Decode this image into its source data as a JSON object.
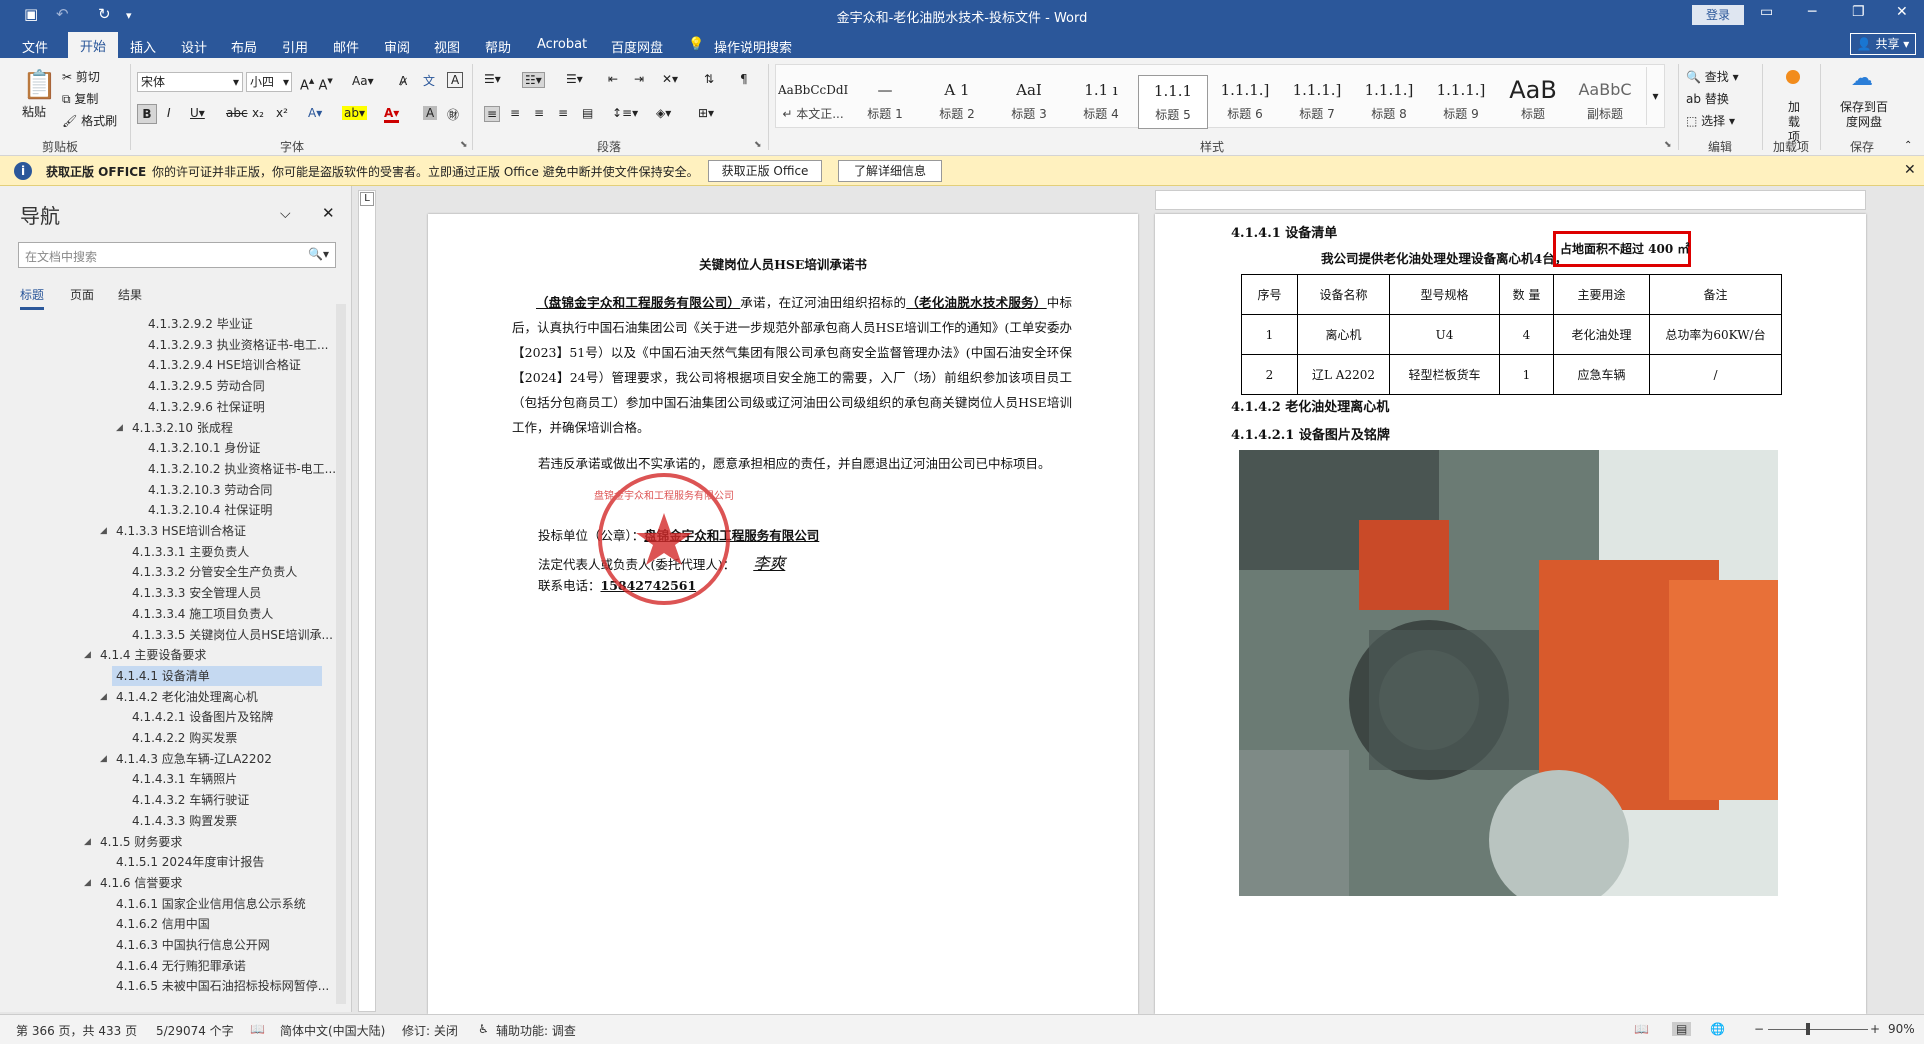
{
  "title_bar": {
    "title": "金宇众和-老化油脱水技术-投标文件 - Word",
    "login": "登录"
  },
  "menu_tabs": [
    "文件",
    "开始",
    "插入",
    "设计",
    "布局",
    "引用",
    "邮件",
    "审阅",
    "视图",
    "帮助",
    "Acrobat",
    "百度网盘"
  ],
  "tell_me": "操作说明搜索",
  "share": "共享",
  "ribbon": {
    "clipboard": {
      "paste": "粘贴",
      "cut": "剪切",
      "copy": "复制",
      "format_painter": "格式刷",
      "label": "剪贴板"
    },
    "font": {
      "name": "宋体",
      "size": "小四",
      "label": "字体"
    },
    "paragraph": {
      "label": "段落"
    },
    "styles": {
      "label": "样式",
      "items": [
        {
          "preview": "AaBbCcDdI",
          "name": "↵ 本文正..."
        },
        {
          "preview": "—",
          "name": "标题 1"
        },
        {
          "preview": "A 1",
          "name": "标题 2"
        },
        {
          "preview": "AaI",
          "name": "标题 3"
        },
        {
          "preview": "1.1 ı",
          "name": "标题 4"
        },
        {
          "preview": "1.1.1",
          "name": "标题 5"
        },
        {
          "preview": "1.1.1.]",
          "name": "标题 6"
        },
        {
          "preview": "1.1.1.]",
          "name": "标题 7"
        },
        {
          "preview": "1.1.1.]",
          "name": "标题 8"
        },
        {
          "preview": "1.1.1.]",
          "name": "标题 9"
        },
        {
          "preview": "AaB",
          "name": "标题"
        },
        {
          "preview": "AaBbC",
          "name": "副标题"
        }
      ]
    },
    "editing": {
      "find": "查找",
      "replace": "替换",
      "select": "选择",
      "label": "编辑"
    },
    "addins": {
      "name": "加载项",
      "label": "加载项"
    },
    "save": {
      "name": "保存到百度网盘",
      "label": "保存"
    }
  },
  "info_bar": {
    "title": "获取正版 OFFICE",
    "message": "你的许可证并非正版，你可能是盗版软件的受害者。立即通过正版 Office 避免中断并使文件保持安全。",
    "btn_get": "获取正版 Office",
    "btn_more": "了解详细信息"
  },
  "nav": {
    "title": "导航",
    "search_placeholder": "在文档中搜索",
    "tabs": [
      "标题",
      "页面",
      "结果"
    ],
    "items": [
      {
        "text": "4.1.3.2.9.2 毕业证",
        "lvl": 4,
        "arrow": "",
        "sel": false
      },
      {
        "text": "4.1.3.2.9.3 执业资格证书-电工...",
        "lvl": 4,
        "arrow": "",
        "sel": false
      },
      {
        "text": "4.1.3.2.9.4 HSE培训合格证",
        "lvl": 4,
        "arrow": "",
        "sel": false
      },
      {
        "text": "4.1.3.2.9.5 劳动合同",
        "lvl": 4,
        "arrow": "",
        "sel": false
      },
      {
        "text": "4.1.3.2.9.6 社保证明",
        "lvl": 4,
        "arrow": "",
        "sel": false
      },
      {
        "text": "4.1.3.2.10 张成程",
        "lvl": 3,
        "arrow": "◢",
        "sel": false
      },
      {
        "text": "4.1.3.2.10.1 身份证",
        "lvl": 4,
        "arrow": "",
        "sel": false
      },
      {
        "text": "4.1.3.2.10.2 执业资格证书-电工...",
        "lvl": 4,
        "arrow": "",
        "sel": false
      },
      {
        "text": "4.1.3.2.10.3 劳动合同",
        "lvl": 4,
        "arrow": "",
        "sel": false
      },
      {
        "text": "4.1.3.2.10.4 社保证明",
        "lvl": 4,
        "arrow": "",
        "sel": false
      },
      {
        "text": "4.1.3.3 HSE培训合格证",
        "lvl": 2,
        "arrow": "◢",
        "sel": false
      },
      {
        "text": "4.1.3.3.1 主要负责人",
        "lvl": 3,
        "arrow": "",
        "sel": false
      },
      {
        "text": "4.1.3.3.2 分管安全生产负责人",
        "lvl": 3,
        "arrow": "",
        "sel": false
      },
      {
        "text": "4.1.3.3.3 安全管理人员",
        "lvl": 3,
        "arrow": "",
        "sel": false
      },
      {
        "text": "4.1.3.3.4 施工项目负责人",
        "lvl": 3,
        "arrow": "",
        "sel": false
      },
      {
        "text": "4.1.3.3.5 关键岗位人员HSE培训承...",
        "lvl": 3,
        "arrow": "",
        "sel": false
      },
      {
        "text": "4.1.4 主要设备要求",
        "lvl": 1,
        "arrow": "◢",
        "sel": false
      },
      {
        "text": "4.1.4.1 设备清单",
        "lvl": 2,
        "arrow": "",
        "sel": true
      },
      {
        "text": "4.1.4.2 老化油处理离心机",
        "lvl": 2,
        "arrow": "◢",
        "sel": false
      },
      {
        "text": "4.1.4.2.1 设备图片及铭牌",
        "lvl": 3,
        "arrow": "",
        "sel": false
      },
      {
        "text": "4.1.4.2.2 购买发票",
        "lvl": 3,
        "arrow": "",
        "sel": false
      },
      {
        "text": "4.1.4.3 应急车辆-辽LA2202",
        "lvl": 2,
        "arrow": "◢",
        "sel": false
      },
      {
        "text": "4.1.4.3.1 车辆照片",
        "lvl": 3,
        "arrow": "",
        "sel": false
      },
      {
        "text": "4.1.4.3.2 车辆行驶证",
        "lvl": 3,
        "arrow": "",
        "sel": false
      },
      {
        "text": "4.1.4.3.3 购置发票",
        "lvl": 3,
        "arrow": "",
        "sel": false
      },
      {
        "text": "4.1.5 财务要求",
        "lvl": 1,
        "arrow": "◢",
        "sel": false
      },
      {
        "text": "4.1.5.1 2024年度审计报告",
        "lvl": 2,
        "arrow": "",
        "sel": false
      },
      {
        "text": "4.1.6 信誉要求",
        "lvl": 1,
        "arrow": "◢",
        "sel": false
      },
      {
        "text": "4.1.6.1 国家企业信用信息公示系统",
        "lvl": 2,
        "arrow": "",
        "sel": false
      },
      {
        "text": "4.1.6.2 信用中国",
        "lvl": 2,
        "arrow": "",
        "sel": false
      },
      {
        "text": "4.1.6.3 中国执行信息公开网",
        "lvl": 2,
        "arrow": "",
        "sel": false
      },
      {
        "text": "4.1.6.4 无行贿犯罪承诺",
        "lvl": 2,
        "arrow": "",
        "sel": false
      },
      {
        "text": "4.1.6.5 未被中国石油招标投标网暂停...",
        "lvl": 2,
        "arrow": "",
        "sel": false
      }
    ]
  },
  "page_left": {
    "title": "关键岗位人员HSE培训承诺书",
    "para1_company": "（盘锦金宇众和工程服务有限公司）",
    "para1_a": "承诺，在辽河油田组织招标的",
    "para1_project": "（老化油脱水技术服务）",
    "para1_b": "中标后，认真执行中国石油集团公司《关于进一步规范外部承包商人员HSE培训工作的通知》(工单安委办【2023】51号）以及《中国石油天然气集团有限公司承包商安全监督管理办法》(中国石油安全环保【2024】24号）管理要求，我公司将根据项目安全施工的需要，入厂（场）前组织参加该项目员工（包括分包商员工）参加中国石油集团公司级或辽河油田公司级组织的承包商关键岗位人员HSE培训工作，并确保培训合格。",
    "para2": "若违反承诺或做出不实承诺的，愿意承担相应的责任，并自愿退出辽河油田公司已中标项目。",
    "bidder_label": "投标单位（公章）：",
    "bidder": "盘锦金宇众和工程服务有限公司",
    "rep_label": "法定代表人或负责人(委托代理人)：",
    "signature": "李爽",
    "phone_label": "联系电话：",
    "phone": "15842742561",
    "seal_text": "盘锦金宇众和工程服务有限公司"
  },
  "page_right": {
    "h_list": "4.1.4.1 设备清单",
    "intro": "我公司提供老化油处理处理设备离心机4台，",
    "highlight": "占地面积不超过 400 ㎡",
    "table_headers": [
      "序号",
      "设备名称",
      "型号规格",
      "数 量",
      "主要用途",
      "备注"
    ],
    "table_rows": [
      [
        "1",
        "离心机",
        "U4",
        "4",
        "老化油处理",
        "总功率为60KW/台"
      ],
      [
        "2",
        "辽L A2202",
        "轻型栏板货车",
        "1",
        "应急车辆",
        "/"
      ]
    ],
    "h_machine": "4.1.4.2 老化油处理离心机",
    "h_photo": "4.1.4.2.1 设备图片及铭牌"
  },
  "status": {
    "page": "第 366 页，共 433 页",
    "words": "5/29074 个字",
    "lang": "简体中文(中国大陆)",
    "track": "修订: 关闭",
    "access": "辅助功能: 调查",
    "zoom": "90%"
  }
}
